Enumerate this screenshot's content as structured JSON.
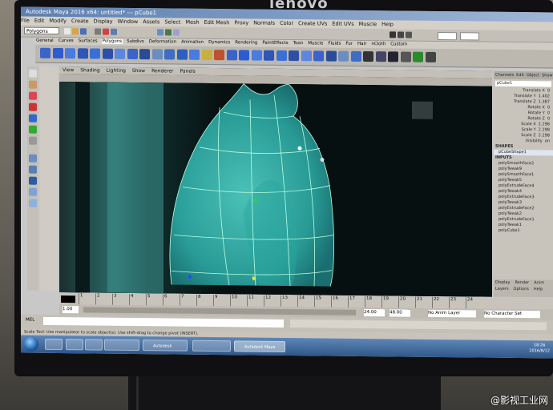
{
  "monitor": {
    "brand": "lenovo"
  },
  "window": {
    "title": "Autodesk Maya 2016 x64: untitled*   ---   pCube1"
  },
  "menubar": {
    "items": [
      "File",
      "Edit",
      "Modify",
      "Create",
      "Display",
      "Window",
      "Assets",
      "Select",
      "Mesh",
      "Edit Mesh",
      "Proxy",
      "Normals",
      "Color",
      "Create UVs",
      "Edit UVs",
      "Muscle",
      "Help"
    ]
  },
  "status_line": {
    "mode": "Polygons"
  },
  "shelf": {
    "tabs": [
      "General",
      "Curves",
      "Surfaces",
      "Polygons",
      "Subdivs",
      "Deformation",
      "Animation",
      "Dynamics",
      "Rendering",
      "PaintEffects",
      "Toon",
      "Muscle",
      "Fluids",
      "Fur",
      "Hair",
      "nCloth",
      "Custom"
    ],
    "active_tab": "Polygons"
  },
  "viewport_panel": {
    "menu": [
      "View",
      "Shading",
      "Lighting",
      "Show",
      "Renderer",
      "Panels"
    ]
  },
  "channel_box": {
    "tabs": [
      "Channels",
      "Edit",
      "Object",
      "Show"
    ],
    "object": "pCube1",
    "attributes": [
      {
        "name": "Translate X",
        "value": "0"
      },
      {
        "name": "Translate Y",
        "value": "1.402"
      },
      {
        "name": "Translate Z",
        "value": "1.387"
      },
      {
        "name": "Rotate X",
        "value": "0"
      },
      {
        "name": "Rotate Y",
        "value": "0"
      },
      {
        "name": "Rotate Z",
        "value": "0"
      },
      {
        "name": "Scale X",
        "value": "2.298"
      },
      {
        "name": "Scale Y",
        "value": "2.298"
      },
      {
        "name": "Scale Z",
        "value": "2.298"
      },
      {
        "name": "Visibility",
        "value": "on"
      }
    ],
    "shapes_label": "SHAPES",
    "shape": "pCubeShape1",
    "inputs_label": "INPUTS",
    "inputs": [
      "polySmoothFace2",
      "polyTweak9",
      "polySmoothFace1",
      "polyTweak5",
      "polyExtrudeFace4",
      "polyTweak4",
      "polyExtrudeFace3",
      "polyTweak3",
      "polyExtrudeFace2",
      "polyTweak2",
      "polyExtrudeFace1",
      "polyTweak1",
      "polyCube1"
    ],
    "bottom_tabs": [
      "Display",
      "Render",
      "Anim"
    ],
    "bottom_row": [
      "Layers",
      "Options",
      "Help"
    ]
  },
  "timeline": {
    "ticks": [
      "1",
      "2",
      "3",
      "4",
      "5",
      "6",
      "7",
      "8",
      "9",
      "10",
      "11",
      "12",
      "13",
      "14",
      "15",
      "16",
      "17",
      "18",
      "19",
      "20",
      "21",
      "22",
      "23",
      "24"
    ],
    "start": "1.00",
    "end": "24.00",
    "range_end": "48.00",
    "current": "1.00"
  },
  "range_slider": {
    "start": "1.00",
    "anim_layer": "No Anim Layer",
    "character_set": "No Character Set"
  },
  "command_line": {
    "label": "MEL"
  },
  "help_line": {
    "text": "Scale Tool: Use manipulator to scale object(s). Use shift-drag to change pivot (INSERT)."
  },
  "taskbar": {
    "buttons": [
      "",
      "",
      "",
      "",
      "Autodesk",
      "",
      "Autodesk Maya"
    ],
    "clock_time": "18:26",
    "clock_date": "2016/8/12"
  },
  "watermark": "@影视工业网",
  "colors": {
    "mesh": "#4fd1c5",
    "wireframe": "#b7ffe2",
    "bg": "#0b1313"
  }
}
